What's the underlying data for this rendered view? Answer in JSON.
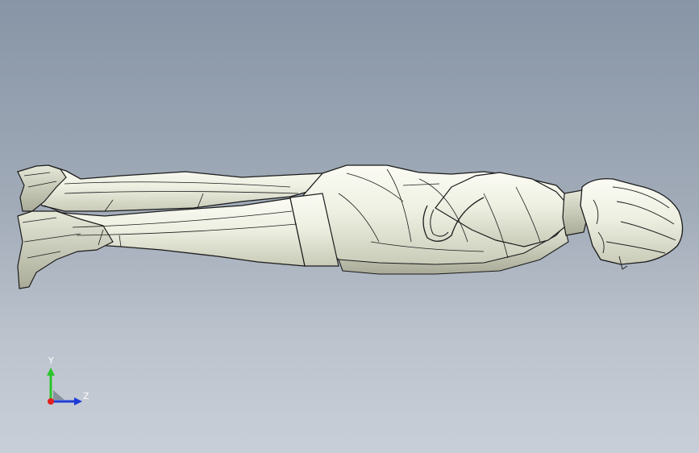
{
  "viewport": {
    "background_top": "#8795a6",
    "background_bottom": "#c9cfd8",
    "model_fill": "#f1f2e8",
    "model_edge": "#1b1b1b"
  },
  "triad": {
    "y_label": "Y",
    "z_label": "Z",
    "y_color": "#2bc42b",
    "z_color": "#1f3bd6",
    "x_color": "#e02020"
  }
}
